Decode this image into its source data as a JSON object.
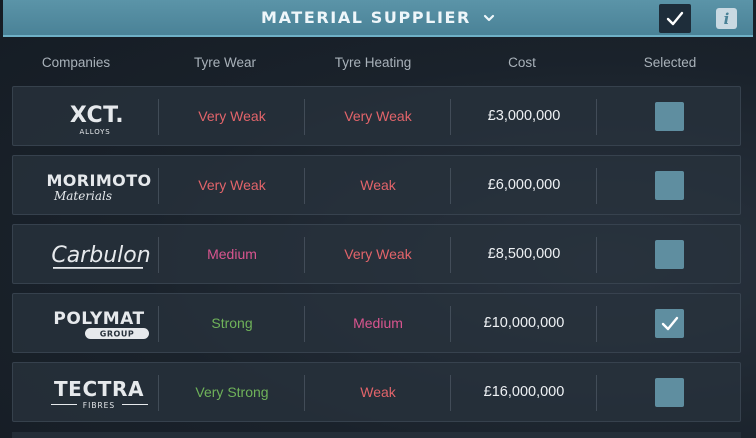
{
  "header": {
    "title": "MATERIAL SUPPLIER",
    "confirm_icon": "checkmark-icon",
    "info_icon": "info-icon",
    "info_glyph": "i"
  },
  "columns": [
    "Companies",
    "Tyre Wear",
    "Tyre Heating",
    "Cost",
    "Selected"
  ],
  "colors": {
    "very_weak": "#e2646a",
    "weak": "#e2646a",
    "medium": "#d9558f",
    "strong": "#6fb25a",
    "very_strong": "#6fb25a",
    "header_bg": "#4a8297",
    "checkbox": "#5f8ea0"
  },
  "rows": [
    {
      "logo": {
        "main": "XCT.",
        "sub": "ALLOYS"
      },
      "tyre_wear": "Very Weak",
      "tyre_heating": "Very Weak",
      "cost": "£3,000,000",
      "selected": false
    },
    {
      "logo": {
        "main": "MORIMOTO",
        "sub": "Materials"
      },
      "tyre_wear": "Very Weak",
      "tyre_heating": "Weak",
      "cost": "£6,000,000",
      "selected": false
    },
    {
      "logo": {
        "main": "Carbulon",
        "sub": ""
      },
      "tyre_wear": "Medium",
      "tyre_heating": "Very Weak",
      "cost": "£8,500,000",
      "selected": false
    },
    {
      "logo": {
        "main": "POLYMAT",
        "sub": "GROUP"
      },
      "tyre_wear": "Strong",
      "tyre_heating": "Medium",
      "cost": "£10,000,000",
      "selected": true
    },
    {
      "logo": {
        "main": "TECTRA",
        "sub": "FIBRES"
      },
      "tyre_wear": "Very Strong",
      "tyre_heating": "Weak",
      "cost": "£16,000,000",
      "selected": false
    }
  ]
}
